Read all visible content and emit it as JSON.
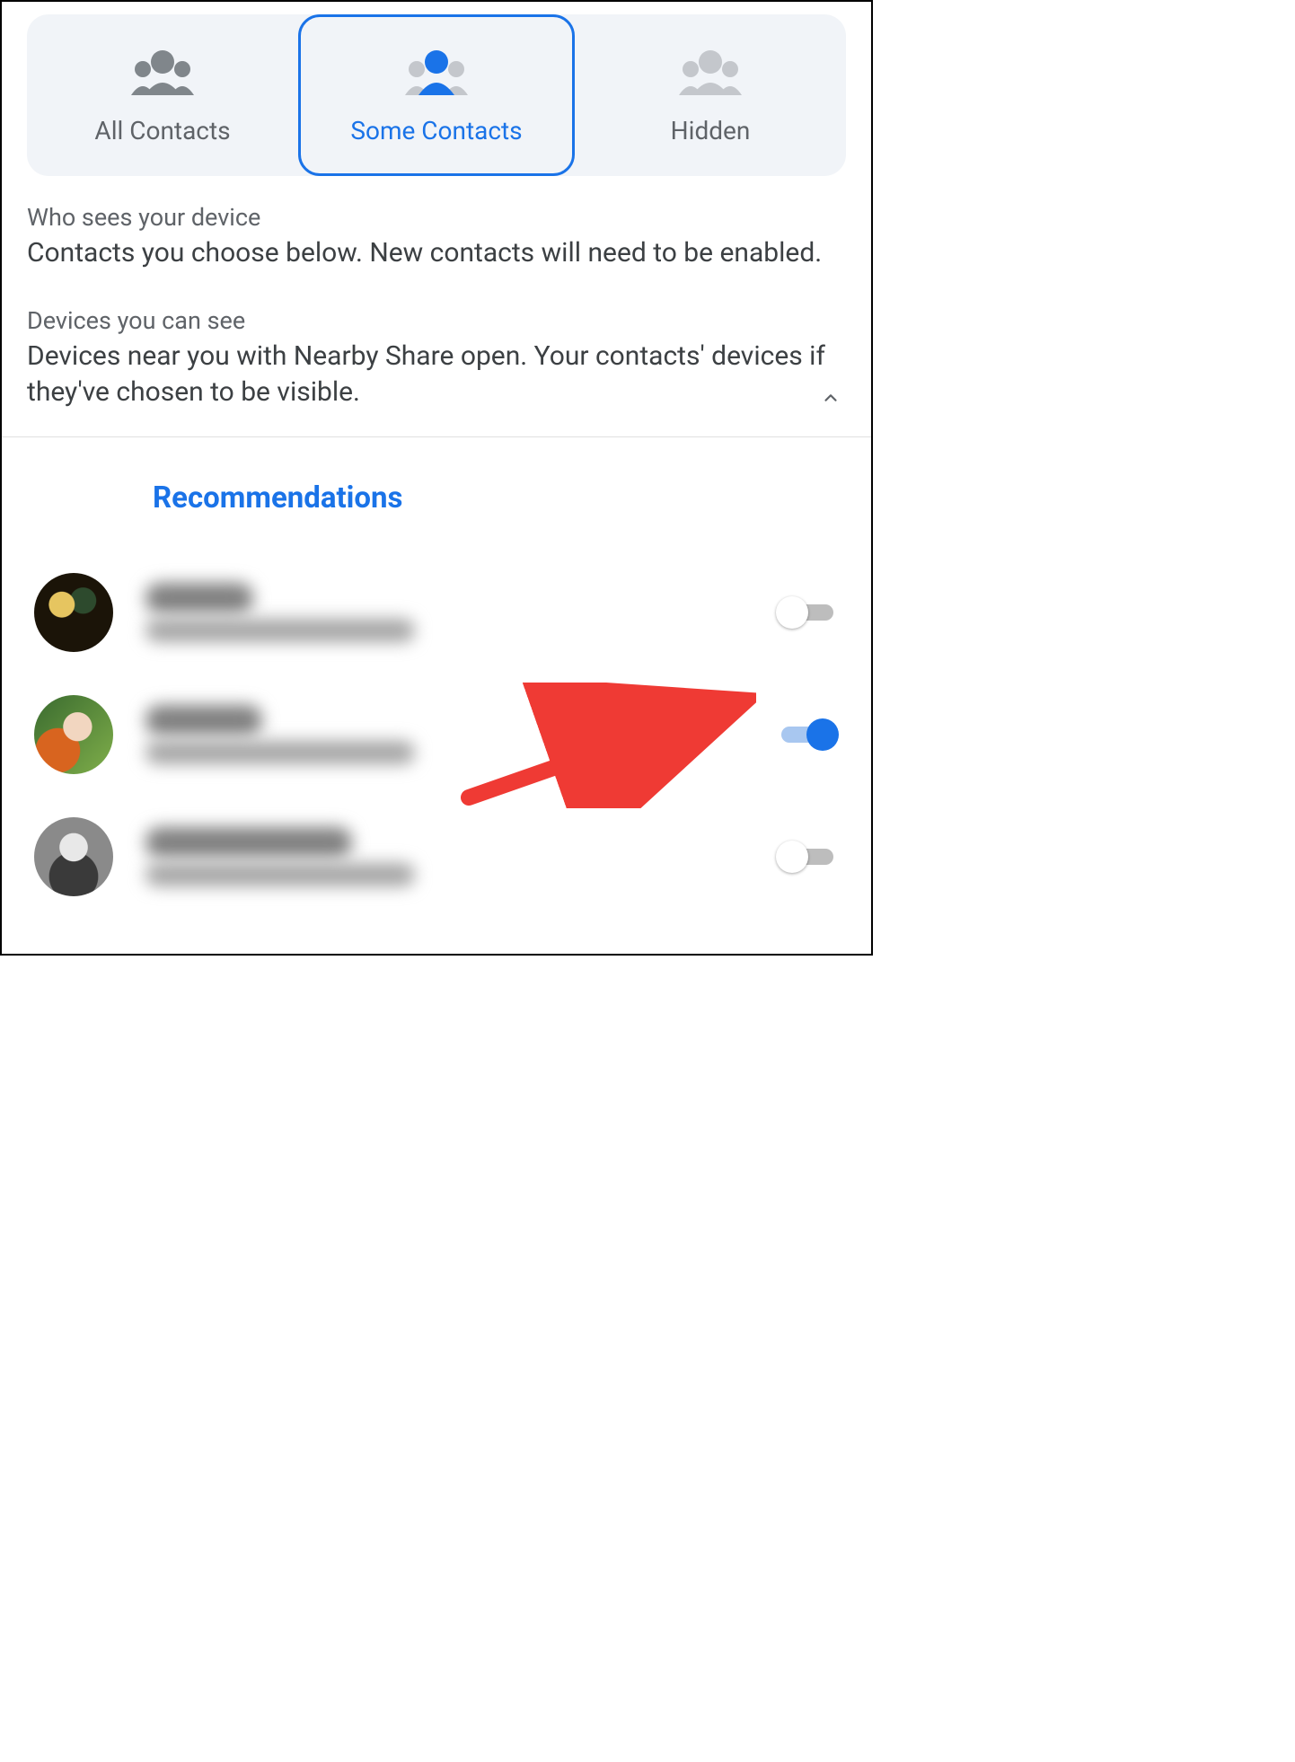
{
  "tabs": {
    "all": {
      "label": "All Contacts",
      "selected": false
    },
    "some": {
      "label": "Some Contacts",
      "selected": true
    },
    "hidden": {
      "label": "Hidden",
      "selected": false
    }
  },
  "who_sees": {
    "title": "Who sees your device",
    "body": "Contacts you choose below. New contacts will need to be enabled."
  },
  "devices_see": {
    "title": "Devices you can see",
    "body": "Devices near you with Nearby Share open. Your contacts' devices if they've chosen to be visible."
  },
  "section_heading": "Recommendations",
  "contacts": [
    {
      "name_redacted": true,
      "sub_redacted": true,
      "enabled": false,
      "avatar_hint": "two-people-photo"
    },
    {
      "name_redacted": true,
      "sub_redacted": true,
      "enabled": true,
      "avatar_hint": "woman-outdoor-photo"
    },
    {
      "name_redacted": true,
      "sub_redacted": true,
      "enabled": false,
      "avatar_hint": "woman-bw-photo"
    }
  ],
  "annotation_arrow_target": "contacts.1.toggle",
  "colors": {
    "accent": "#1a73e8"
  }
}
